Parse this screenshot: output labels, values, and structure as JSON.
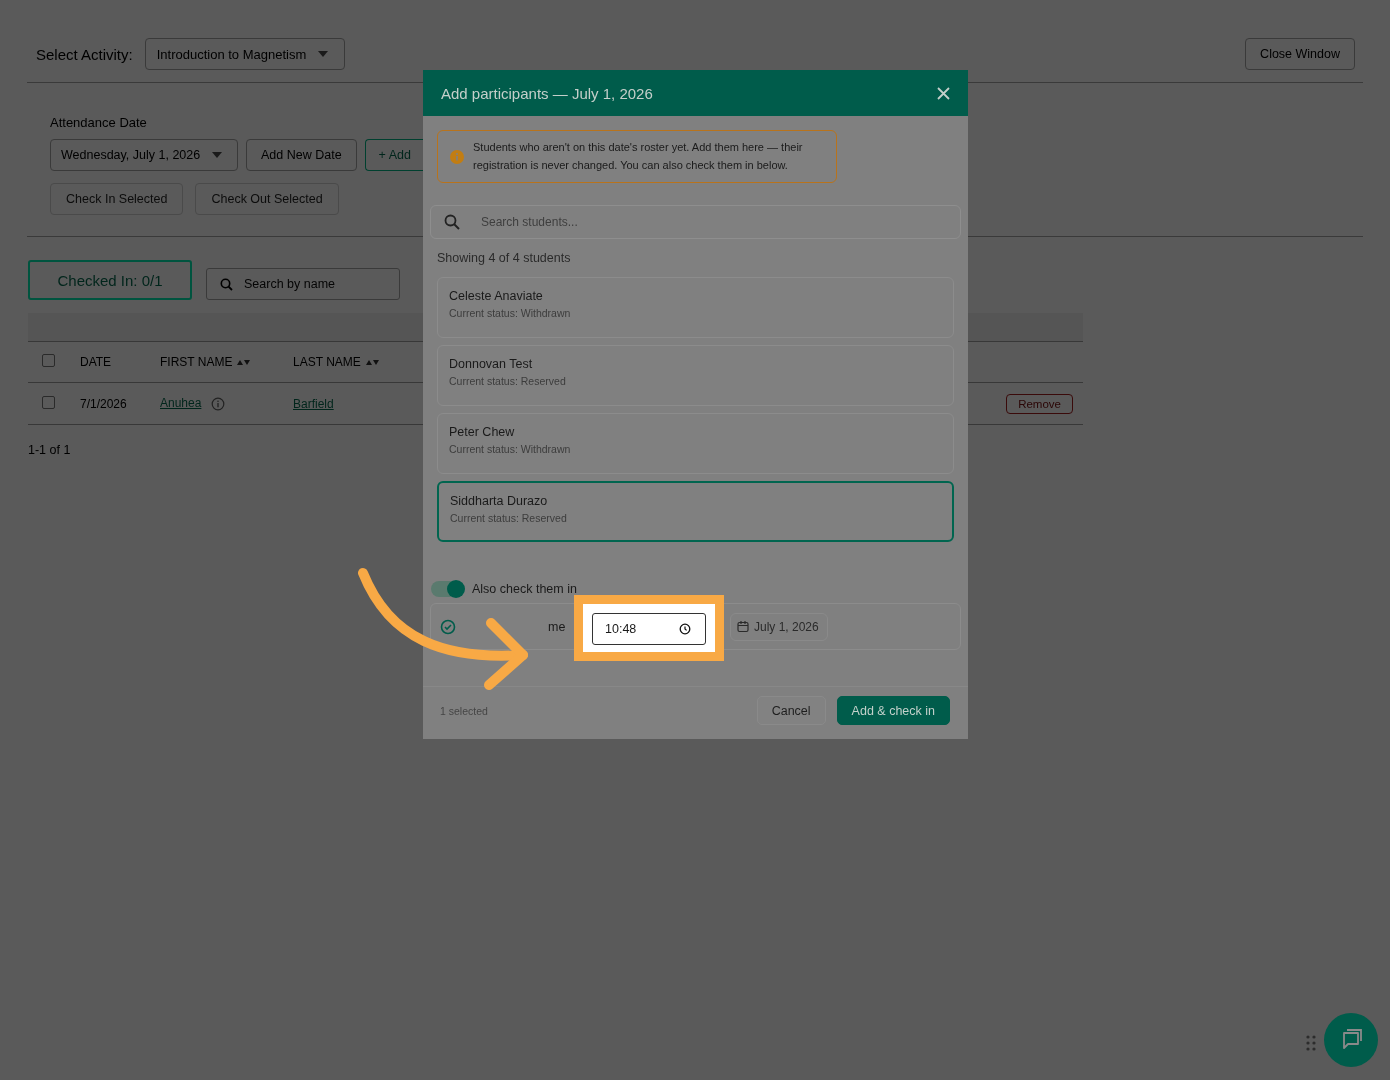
{
  "header": {
    "activity_label": "Select Activity:",
    "activity": "Introduction to Magnetism",
    "close_button": "Close Window"
  },
  "attendance": {
    "label": "Attendance Date",
    "date": "Wednesday, July 1, 2026",
    "buttons": [
      {
        "label": "Add New Date",
        "kind": "plain"
      },
      {
        "label": "+ Add",
        "kind": "outline"
      }
    ],
    "bulk_actions": [
      {
        "label": "Check In Selected",
        "disabled": true
      },
      {
        "label": "Check Out Selected",
        "disabled": true
      }
    ]
  },
  "summary": {
    "checked_in": "Checked In: 0/1",
    "search_placeholder": "Search by name"
  },
  "table": {
    "select_all_checked": false,
    "columns": [
      {
        "label": "DATE",
        "sortable": false
      },
      {
        "label": "FIRST NAME",
        "sortable": true
      },
      {
        "label": "LAST NAME",
        "sortable": true
      }
    ],
    "rows": [
      {
        "checked": false,
        "date": "7/1/2026",
        "first_name": "Anuhea",
        "last_name": "Barfield",
        "action": "Remove"
      }
    ],
    "pagination": "1-1 of 1"
  },
  "dialog": {
    "title": "Add participants — July 1, 2026",
    "notice": "Students who aren't on this date's roster yet. Add them here — their registration is never changed. You can also check them in below.",
    "search_placeholder": "Search students...",
    "count": "Showing 4 of 4 students",
    "students": [
      {
        "name": "Celeste Anaviate",
        "status": "Current status: Withdrawn",
        "selected": false
      },
      {
        "name": "Donnovan Test",
        "status": "Current status: Reserved",
        "selected": false
      },
      {
        "name": "Peter Chew",
        "status": "Current status: Withdrawn",
        "selected": false
      },
      {
        "name": "Siddharta Durazo",
        "status": "Current status: Reserved",
        "selected": true
      }
    ],
    "check_in_toggle": {
      "label": "Also check them in",
      "on": true
    },
    "time_label": "me",
    "time": "10:48",
    "date": "July 1, 2026",
    "selection_count": "1 selected",
    "buttons": [
      {
        "label": "Cancel",
        "kind": "secondary"
      },
      {
        "label": "Add & check in",
        "kind": "primary"
      }
    ]
  }
}
